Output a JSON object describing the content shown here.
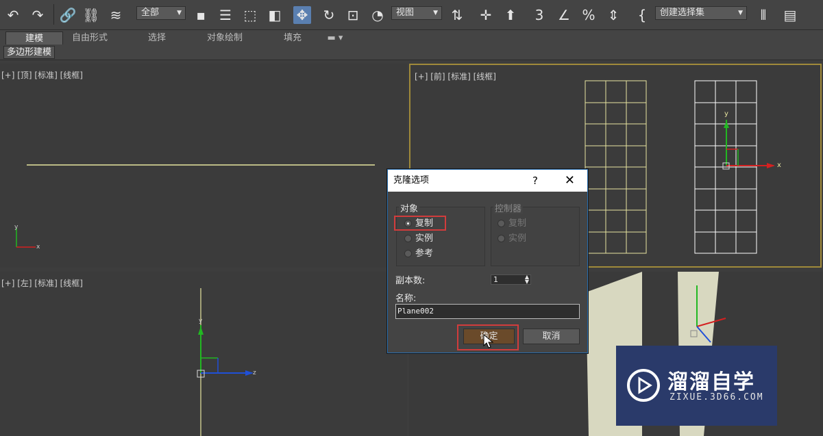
{
  "toolbar": {
    "selection_filter": "全部",
    "ref_coord": "视图",
    "named_selection": "创建选择集",
    "icons": [
      "undo-icon",
      "redo-icon",
      "link-icon",
      "unlink-icon",
      "bind-space-warp-icon",
      "select-object-icon",
      "select-by-name-icon",
      "rect-region-icon",
      "window-crossing-icon",
      "move-icon",
      "rotate-icon",
      "scale-icon",
      "place-icon",
      "pivot-icon",
      "mirror-icon",
      "snap-3d-icon",
      "angle-snap-icon",
      "percent-snap-icon",
      "spinner-snap-icon",
      "edit-named-sets-icon",
      "mirror-tool-icon",
      "align-icon"
    ]
  },
  "ribbon": {
    "tabs": [
      "建模",
      "自由形式",
      "选择",
      "对象绘制",
      "填充"
    ],
    "active_tab": "建模",
    "subtab": "多边形建模"
  },
  "viewports": {
    "top": "[+] [顶] [标准] [线框]",
    "front": "[+] [前] [标准] [线框]",
    "left": "[+] [左] [标准] [线框]",
    "axis_x": "x",
    "axis_y": "y",
    "axis_z": "z"
  },
  "dialog": {
    "title": "克隆选项",
    "help": "?",
    "close": "✕",
    "object_group": "对象",
    "controller_group": "控制器",
    "object_options": [
      "复制",
      "实例",
      "参考"
    ],
    "object_selected": "复制",
    "controller_options": [
      "复制",
      "实例"
    ],
    "copies_label": "副本数:",
    "copies_value": "1",
    "name_label": "名称:",
    "name_value": "Plane002",
    "ok": "确定",
    "cancel": "取消"
  },
  "watermark": {
    "title": "溜溜自学",
    "subtitle": "ZIXUE.3D66.COM"
  },
  "colors": {
    "active_border": "#a08a3a",
    "grid_yellow": "#e8e6a0",
    "highlight_red": "#d23c3c",
    "dialog_border": "#2a6fb0"
  }
}
